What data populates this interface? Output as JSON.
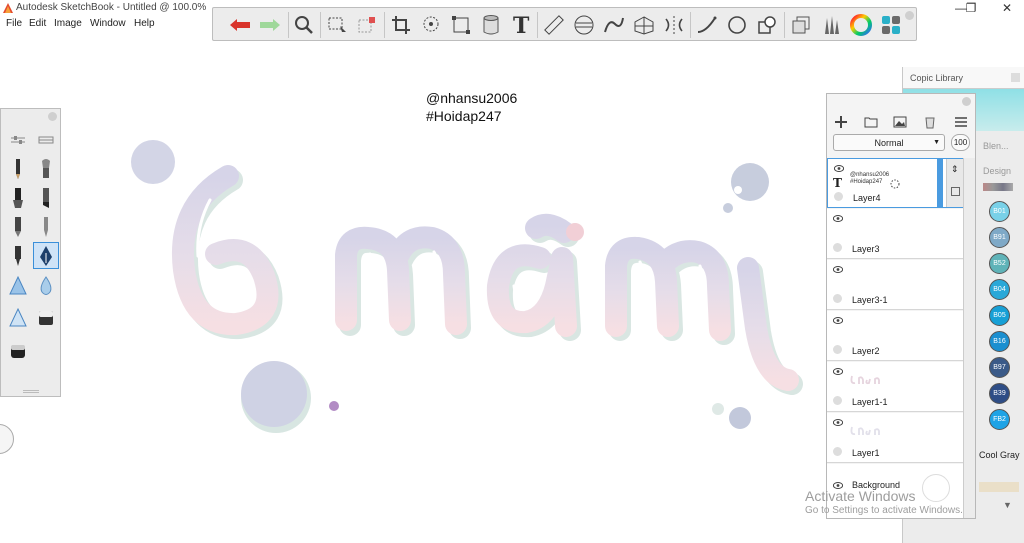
{
  "window": {
    "title": "Autodesk SketchBook - Untitled @ 100.0%",
    "controls": [
      "—",
      "❐",
      "✕"
    ]
  },
  "menu": [
    "File",
    "Edit",
    "Image",
    "Window",
    "Help"
  ],
  "toolbar": {
    "tools": [
      "undo-icon",
      "redo-icon",
      "zoom-icon",
      "select-icon",
      "transform-select-icon",
      "crop-icon",
      "lasso-icon",
      "distort-icon",
      "fill-icon",
      "text-icon",
      "ruler-icon",
      "ellipse-guide-icon",
      "french-curve-icon",
      "perspective-icon",
      "symmetry-icon",
      "stroke-icon",
      "shape-icon",
      "shapes-icon",
      "layers-icon",
      "brushes-icon",
      "color-wheel-icon",
      "copic-icon"
    ]
  },
  "canvas": {
    "watermark_line1": "@nhansu2006",
    "watermark_line2": "#Hoidap247",
    "colors": {
      "lettering": "#dcd8ea",
      "lettering_pink": "#f4dde2",
      "shadow": "#d8e8e4",
      "bubble": "#cdd0e2",
      "accent": "#b28bc4"
    }
  },
  "copic_library": {
    "title": "Copic Library",
    "label_blend": "Blen...",
    "label_design": "Design",
    "label_cool_gray": "Cool Gray",
    "swatches": [
      {
        "code": "B01",
        "color": "#79d1e8"
      },
      {
        "code": "B91",
        "color": "#7fa9c7"
      },
      {
        "code": "B52",
        "color": "#5fb3b8"
      },
      {
        "code": "B04",
        "color": "#2aa8d8"
      },
      {
        "code": "B05",
        "color": "#17a0d6"
      },
      {
        "code": "B16",
        "color": "#1b8fd0"
      },
      {
        "code": "B97",
        "color": "#3a5a88"
      },
      {
        "code": "B39",
        "color": "#2e4d86"
      },
      {
        "code": "FB2",
        "color": "#1ea3e6"
      }
    ]
  },
  "layers_panel": {
    "blend_mode": "Normal",
    "opacity": "100",
    "layers": [
      {
        "name": "Layer4",
        "selected": true,
        "thumb_line1": "@nhansu2006",
        "thumb_line2": "#Hoidap247"
      },
      {
        "name": "Layer3",
        "selected": false
      },
      {
        "name": "Layer3-1",
        "selected": false
      },
      {
        "name": "Layer2",
        "selected": false
      },
      {
        "name": "Layer1-1",
        "selected": false
      },
      {
        "name": "Layer1",
        "selected": false
      },
      {
        "name": "Background",
        "selected": false
      }
    ]
  },
  "os_notice": {
    "line1": "Activate Windows",
    "line2": "Go to Settings to activate Windows."
  }
}
